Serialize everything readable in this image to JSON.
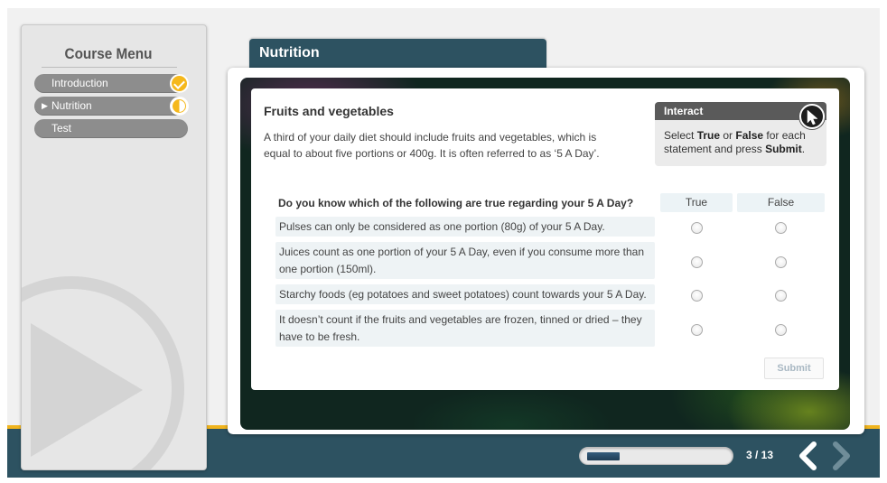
{
  "sidebar": {
    "title": "Course Menu",
    "items": [
      {
        "label": "Introduction",
        "status": "complete",
        "current": false
      },
      {
        "label": "Nutrition",
        "status": "in-progress",
        "current": true
      },
      {
        "label": "Test",
        "status": "none",
        "current": false
      }
    ]
  },
  "tab": {
    "title": "Nutrition"
  },
  "content": {
    "heading": "Fruits and vegetables",
    "intro": "A third of your daily diet should include fruits and vegetables, which is equal to about five portions or 400g. It is often referred to as ‘5 A Day’."
  },
  "interact": {
    "title": "Interact",
    "text_1": "Select ",
    "true_word": "True",
    "text_2": " or ",
    "false_word": "False",
    "text_3": " for each statement and press ",
    "submit_word": "Submit",
    "text_4": "."
  },
  "quiz": {
    "question": "Do you know which of the following are true regarding your 5 A Day?",
    "true_label": "True",
    "false_label": "False",
    "statements": [
      "Pulses can only be considered as one portion (80g) of your 5 A Day.",
      "Juices count as one portion of your 5 A Day, even if you consume more than one portion (150ml).",
      "Starchy foods (eg potatoes and sweet potatoes) count towards your 5 A Day.",
      "It doesn’t count if the fruits and vegetables are frozen, tinned or dried – they have to be fresh."
    ],
    "submit_label": "Submit"
  },
  "nav": {
    "page_text": "3 / 13",
    "progress_fraction": 0.23
  },
  "colors": {
    "accent": "#f5b81c",
    "dark_teal": "#2d5261",
    "menu_pill": "#8d8d8d"
  }
}
